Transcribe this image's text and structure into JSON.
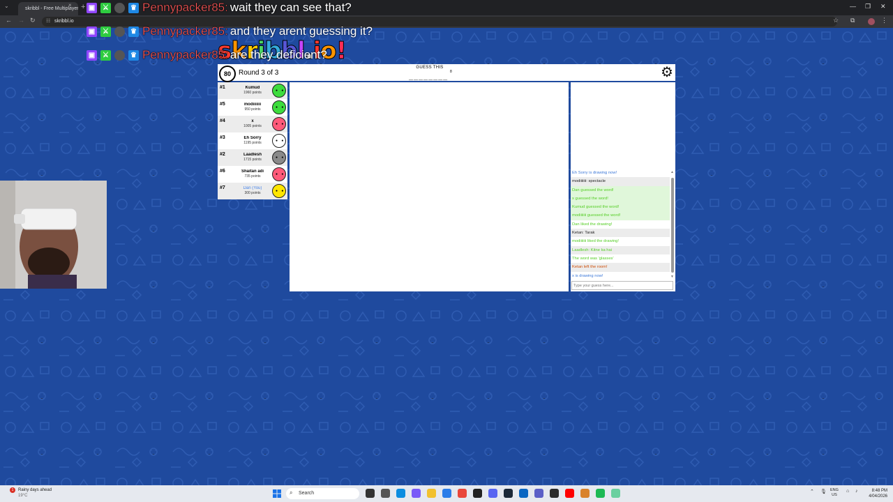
{
  "browser": {
    "tab_title": "skribbl - Free Multiplayer D",
    "tab_close": "×",
    "new_tab": "+",
    "url": "skribbl.io",
    "window_controls": [
      "—",
      "❐",
      "✕"
    ]
  },
  "stream_chat": [
    {
      "user": "Pennypacker85",
      "message": "wait they can see that?"
    },
    {
      "user": "Pennypacker85",
      "message": "and they arent guessing it?"
    },
    {
      "user": "Pennypacker85",
      "message": "are they deficient?"
    }
  ],
  "game": {
    "logo_letters": [
      "s",
      "k",
      "r",
      "i",
      "b",
      "b",
      "l",
      ".",
      "i",
      "o",
      "!"
    ],
    "logo_colors": [
      "#ff3b30",
      "#ff9500",
      "#ffcc00",
      "#4cd964",
      "#34aadc",
      "#5856d6",
      "#c644fc",
      "#ffffff",
      "#ff3b30",
      "#ff9500",
      "#ff2d55"
    ],
    "timer": "80",
    "round": "Round 3 of 3",
    "guess_label": "GUESS THIS",
    "hint": "________",
    "word_length": "8",
    "players": [
      {
        "rank": "#1",
        "name": "Kumud",
        "points": "1960 points",
        "color": "#3ddc3d"
      },
      {
        "rank": "#5",
        "name": "modiiiiiii",
        "points": "950 points",
        "color": "#3ddc3d"
      },
      {
        "rank": "#4",
        "name": "x",
        "points": "1005 points",
        "color": "#ff5a7a"
      },
      {
        "rank": "#3",
        "name": "Eh Sorry",
        "points": "1195 points",
        "color": "#ffffff"
      },
      {
        "rank": "#2",
        "name": "Laadlesh",
        "points": "1715 points",
        "color": "#8a8a8a"
      },
      {
        "rank": "#6",
        "name": "Shaitan adi",
        "points": "735 points",
        "color": "#ff5a7a"
      },
      {
        "rank": "#7",
        "name": "Dan (You)",
        "points": "300 points",
        "color": "#ffe600"
      }
    ],
    "chat": [
      {
        "text": "Eh Sorry is drawing now!",
        "color": "#3c78d8",
        "bg": "white"
      },
      {
        "text": "modiiiiiii: spectacle",
        "color": "#222222",
        "bg": "grey"
      },
      {
        "text": "Dan guessed the word!",
        "color": "#56ce27",
        "bg": "green"
      },
      {
        "text": "x guessed the word!",
        "color": "#56ce27",
        "bg": "green"
      },
      {
        "text": "Kumud guessed the word!",
        "color": "#56ce27",
        "bg": "green"
      },
      {
        "text": "modiiiiiii guessed the word!",
        "color": "#56ce27",
        "bg": "green"
      },
      {
        "text": "Dan liked the drawing!",
        "color": "#56ce27",
        "bg": "white"
      },
      {
        "text": "Ketan: Tarak",
        "color": "#222222",
        "bg": "grey"
      },
      {
        "text": "modiiiiiii liked the drawing!",
        "color": "#56ce27",
        "bg": "white"
      },
      {
        "text": "Laadlesh: Kitne ka hai",
        "color": "#56ce27",
        "bg": "grey"
      },
      {
        "text": "The word was 'glasses'",
        "color": "#56ce27",
        "bg": "white"
      },
      {
        "text": "Ketan left the room!",
        "color": "#ce4f0a",
        "bg": "grey"
      },
      {
        "text": "x is drawing now!",
        "color": "#3c78d8",
        "bg": "white"
      }
    ],
    "chat_placeholder": "Type your guess here..."
  },
  "taskbar": {
    "weather_title": "Rainy days ahead",
    "weather_temp": "19°C",
    "search_label": "Search",
    "lang_1": "ENG",
    "lang_2": "US",
    "time": "8:48 PM",
    "date": "4/04/2026"
  }
}
